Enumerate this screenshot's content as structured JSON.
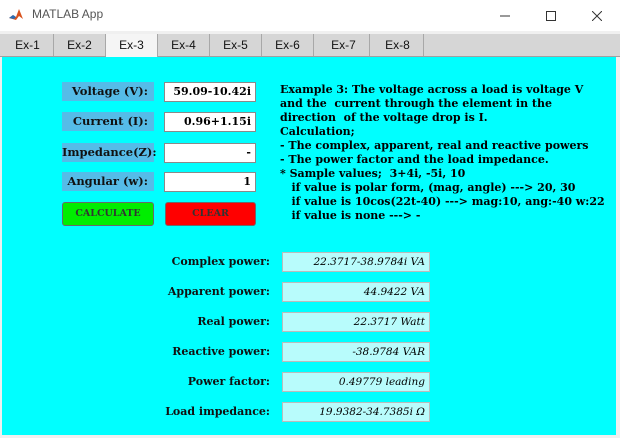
{
  "window": {
    "title": "MATLAB App"
  },
  "tabs": [
    "Ex-1",
    "Ex-2",
    "Ex-3",
    "Ex-4",
    "Ex-5",
    "Ex-6",
    "Ex-7",
    "Ex-8"
  ],
  "active_tab": "Ex-3",
  "inputs": [
    {
      "label": "Voltage (V):",
      "value": "59.09-10.42i"
    },
    {
      "label": "Current (I):",
      "value": "0.96+1.15i"
    },
    {
      "label": "Impedance(Z):",
      "value": "-"
    },
    {
      "label": "Angular (w):",
      "value": "1"
    }
  ],
  "buttons": {
    "calculate": "CALCULATE",
    "clear": "CLEAR"
  },
  "description": [
    "Example 3: The voltage across a load is voltage V",
    "and the  current through the element in the",
    "direction  of the voltage drop is I.",
    "Calculation;",
    "- The complex, apparent, real and reactive powers",
    "- The power factor and the load impedance.",
    "* Sample values;  3+4i, -5i, 10",
    "   if value is polar form, (mag, angle) ---> 20, 30",
    "   if value is 10cos(22t-40) ---> mag:10, ang:-40 w:22",
    "   if value is none ---> -"
  ],
  "results": [
    {
      "label": "Complex power:",
      "value": "22.3717-38.9784i VA"
    },
    {
      "label": "Apparent power:",
      "value": "44.9422 VA"
    },
    {
      "label": "Real power:",
      "value": "22.3717 Watt"
    },
    {
      "label": "Reactive power:",
      "value": "-38.9784 VAR"
    },
    {
      "label": "Power factor:",
      "value": "0.49779 leading"
    },
    {
      "label": "Load impedance:",
      "value": "19.9382-34.7385i Ω"
    }
  ],
  "colors": {
    "panel": "#00ffff",
    "label_bg": "#55bce8",
    "calculate": "#00ee00",
    "clear": "#ff0000",
    "output_bg": "#b8fcfc"
  }
}
